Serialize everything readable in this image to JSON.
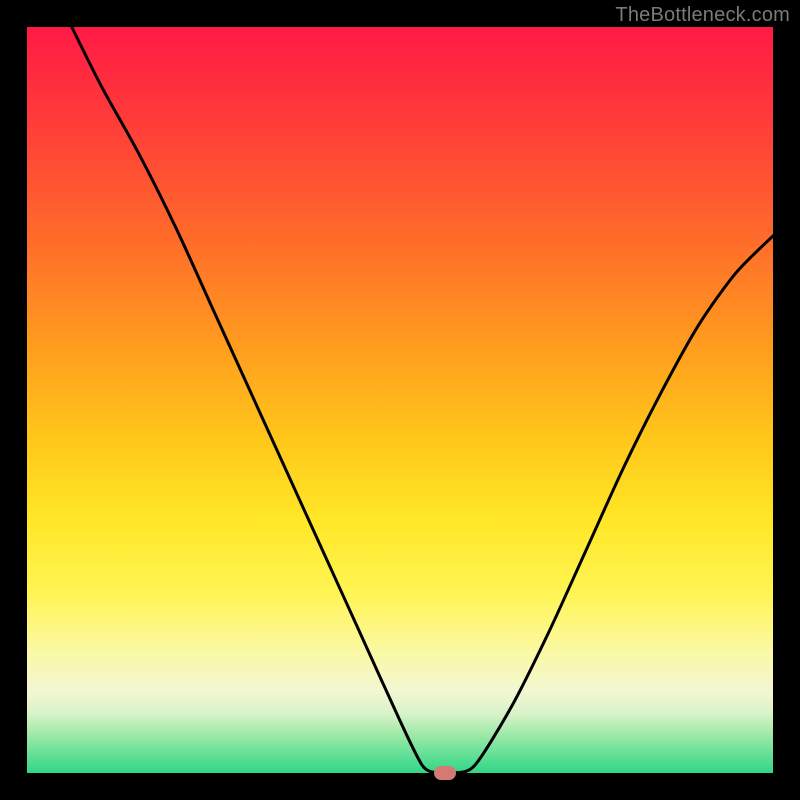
{
  "watermark": "TheBottleneck.com",
  "chart_data": {
    "type": "line",
    "title": "",
    "xlabel": "",
    "ylabel": "",
    "xlim": [
      0,
      100
    ],
    "ylim": [
      0,
      100
    ],
    "x": [
      6,
      10,
      15,
      20,
      25,
      30,
      35,
      40,
      45,
      50,
      53,
      55,
      57,
      60,
      65,
      70,
      75,
      80,
      85,
      90,
      95,
      100
    ],
    "y": [
      100,
      92,
      83,
      73,
      62,
      51,
      40,
      29,
      18,
      7,
      1,
      0,
      0,
      1,
      9,
      19,
      30,
      41,
      51,
      60,
      67,
      72
    ],
    "minimum_marker": {
      "x": 56,
      "y": 0,
      "color": "#d47a74"
    },
    "background_gradient": {
      "top": "#ff1a45",
      "bottom": "#2fd787"
    }
  }
}
